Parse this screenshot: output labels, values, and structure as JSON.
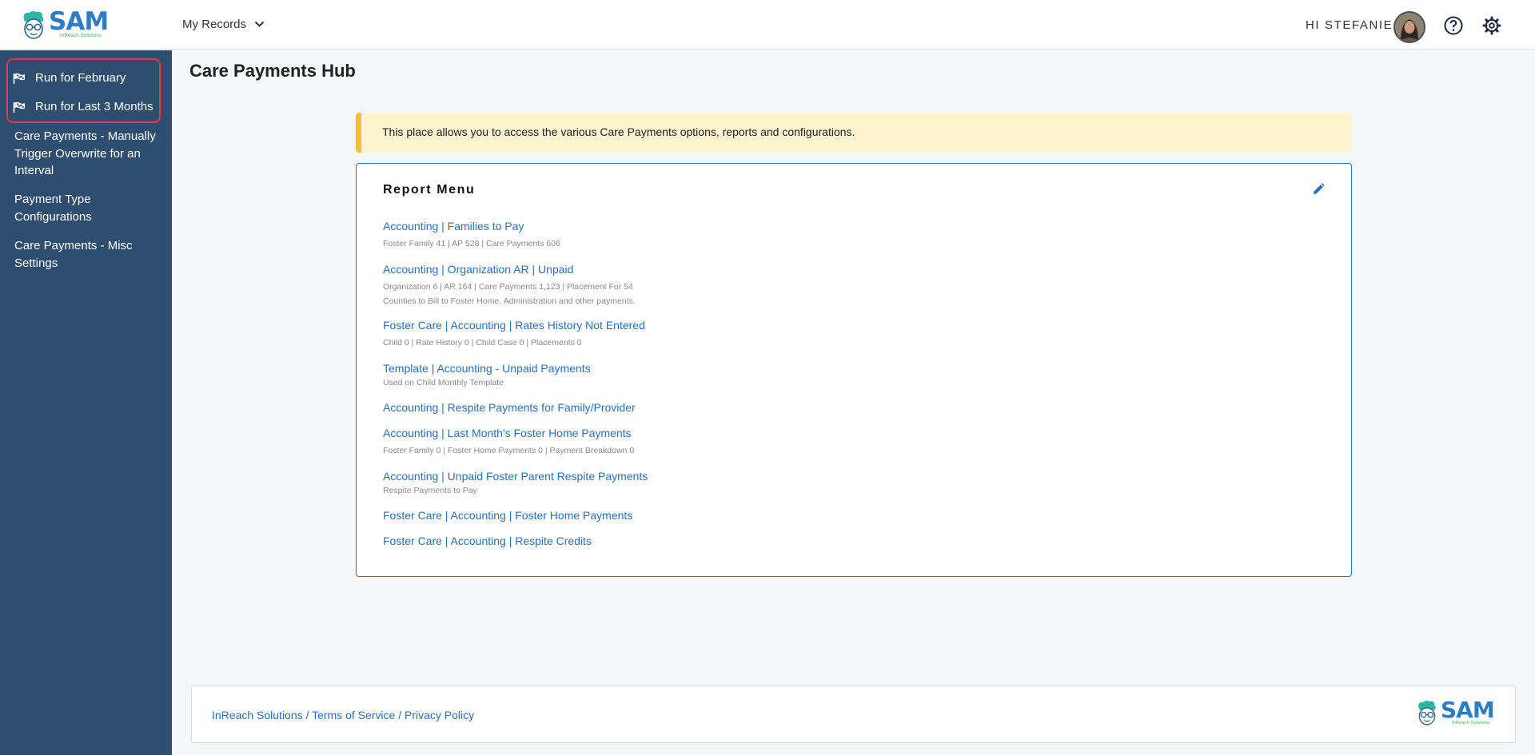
{
  "header": {
    "logo_text": "SAM",
    "logo_subtext": "InReach Solutions",
    "records_menu_label": "My Records",
    "greeting": "HI STEFANIE",
    "icons": {
      "help": "question-circle-icon",
      "settings": "gear-icon",
      "records": "chevron-down-icon"
    }
  },
  "sidebar": {
    "run_items": [
      {
        "label": "Run for February",
        "icon": "flag-icon"
      },
      {
        "label": "Run for Last 3 Months",
        "icon": "flag-icon"
      }
    ],
    "links": [
      {
        "label": "Care Payments - Manually Trigger Overwrite for an Interval"
      },
      {
        "label": "Payment Type Configurations"
      },
      {
        "label": "Care Payments - Misc Settings"
      }
    ]
  },
  "page": {
    "title": "Care Payments Hub",
    "notice": "This place allows you to access the various Care Payments options, reports and configurations."
  },
  "report_menu": {
    "title": "Report Menu",
    "items": [
      {
        "label": "Accounting | Families to Pay",
        "desc": [
          "Foster Family 41 | AP 528 | Care Payments 606"
        ]
      },
      {
        "label": "Accounting | Organization AR | Unpaid",
        "desc": [
          "Organization 6 | AR 164 | Care Payments 1,123 | Placement For 54",
          "Counties to Bill to Foster Home, Administration and other payments."
        ]
      },
      {
        "label": "Foster Care | Accounting | Rates History Not Entered",
        "desc": [
          "Child 0 | Rate History 0 | Child Case 0 | Placements 0"
        ]
      },
      {
        "label": "Template | Accounting - Unpaid Payments",
        "desc": [
          "Used on Child Monthly Template"
        ]
      },
      {
        "label": "Accounting | Respite Payments for Family/Provider",
        "desc": []
      },
      {
        "label": "Accounting | Last Month's Foster Home Payments",
        "desc": [
          "Foster Family 0 | Foster Home Payments 0 | Payment Breakdown 0"
        ]
      },
      {
        "label": "Accounting | Unpaid Foster Parent Respite Payments",
        "desc": [
          "Respite Payments to Pay"
        ]
      },
      {
        "label": "Foster Care | Accounting | Foster Home Payments",
        "desc": []
      },
      {
        "label": "Foster Care | Accounting | Respite Credits",
        "desc": []
      }
    ]
  },
  "footer": {
    "links": [
      "InReach Solutions",
      "Terms of Service",
      "Privacy Policy"
    ],
    "separator": " / ",
    "logo_text": "SAM",
    "logo_subtext": "InReach Solutions"
  },
  "colors": {
    "sidebar_bg": "#2f4d6f",
    "link": "#2a6ebd",
    "notice_bg": "#fcf3cf",
    "notice_accent": "#f2c12e",
    "highlight_box": "#e03c3c"
  }
}
